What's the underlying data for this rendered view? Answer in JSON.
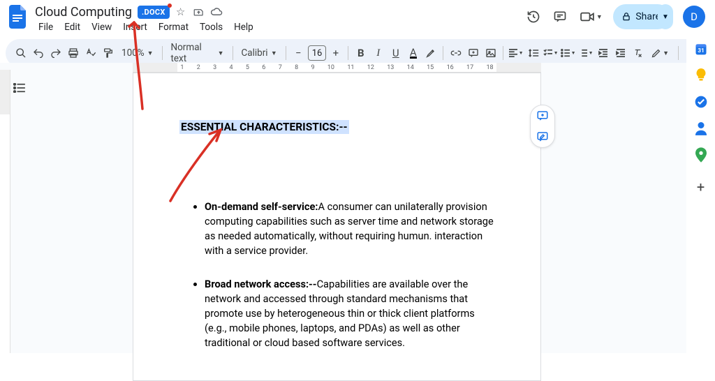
{
  "header": {
    "doc_title": "Cloud Computing",
    "docx_badge": ".DOCX",
    "menus": [
      "File",
      "Edit",
      "View",
      "Insert",
      "Format",
      "Tools",
      "Help"
    ],
    "share_label": "Share",
    "avatar_letter": "D"
  },
  "toolbar": {
    "zoom": "100%",
    "style_select": "Normal text",
    "font_select": "Calibri",
    "font_size": "16",
    "text_color_letter": "A"
  },
  "ruler": {
    "ticks": [
      "1",
      "2",
      "3",
      "4",
      "5",
      "6",
      "7",
      "8",
      "9",
      "10",
      "11",
      "12",
      "13",
      "14",
      "15",
      "16",
      "17",
      "18"
    ]
  },
  "document": {
    "heading": "ESSENTIAL CHARACTERISTICS:--",
    "bullets": [
      {
        "title": "On-demand self-service:",
        "body": "A consumer can unilaterally provision computing capabilities such as server time and network storage as needed automatically, without requiring humun. interaction with a service provider."
      },
      {
        "title": "Broad network access:--",
        "body": "Capabilities are available over the network and accessed through standard mechanisms that promote use by heterogeneous thin or thick client platforms (e.g., mobile phones, laptops, and PDAs) as well as other traditional or cloud based software services."
      }
    ]
  },
  "colors": {
    "accent": "#1a73e8",
    "share_bg": "#c2e7ff",
    "annotation": "#d93025"
  }
}
